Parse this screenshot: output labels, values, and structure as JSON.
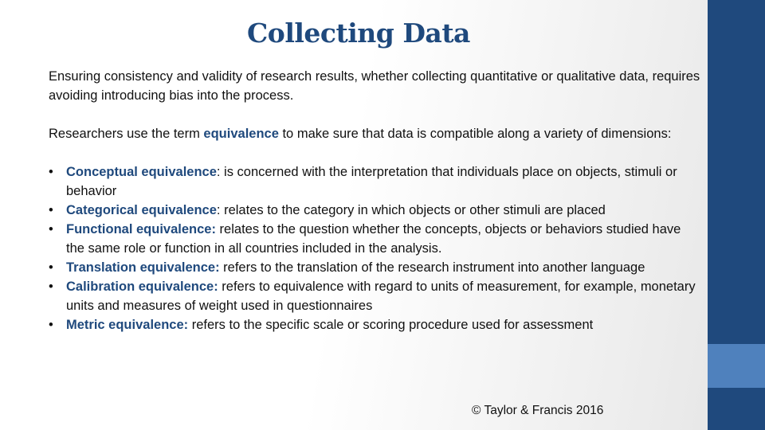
{
  "slide": {
    "title": "Collecting Data",
    "intro": "Ensuring consistency and validity of research results, whether collecting quantitative or qualitative data, requires avoiding introducing bias into the process.",
    "definition": {
      "before": "Researchers use the term ",
      "term": "equivalence",
      "after": " to make sure that data is compatible along a variety of dimensions:"
    },
    "bullet_glyph": "•",
    "items": [
      {
        "term": "Conceptual equivalence",
        "text": ": is concerned with the interpretation that individuals place on objects, stimuli or behavior"
      },
      {
        "term": "Categorical equivalence",
        "text": ": relates to the category in which objects or other stimuli are placed"
      },
      {
        "term": "Functional equivalence:",
        "text": " relates to the question whether the concepts, objects or behaviors studied have the same role or function in all countries included in the analysis."
      },
      {
        "term": "Translation equivalence:",
        "text": " refers to the translation of the research instrument into another language"
      },
      {
        "term": "Calibration equivalence:",
        "text": " refers to equivalence with regard to units of measurement, for example, monetary units and measures of weight used in questionnaires"
      },
      {
        "term": "Metric equivalence:",
        "text": " refers to the specific scale or scoring procedure used for assessment"
      }
    ],
    "footer": "© Taylor & Francis 2016"
  },
  "colors": {
    "accent": "#1f497d",
    "accent_light": "#4f81bd"
  }
}
